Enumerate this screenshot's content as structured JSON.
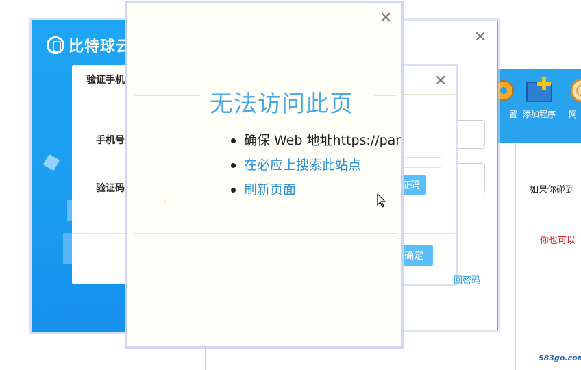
{
  "front_dialog": {
    "close_glyph": "✕",
    "title": "无法访问此页",
    "suggestions": [
      {
        "text": "确保 Web 地址https://par",
        "type": "plain"
      },
      {
        "text": "在必应上搜索此站点",
        "type": "link"
      },
      {
        "text": "刷新页面",
        "type": "link"
      }
    ]
  },
  "login_window": {
    "logo_text": "比特球云",
    "verify_dialog": {
      "title": "验证手机",
      "phone_label": "手机号",
      "code_label": "验证码"
    }
  },
  "middle_dialog": {
    "close_glyph": "✕",
    "inner_close_glyph": "✕",
    "get_code_button": "证码",
    "confirm_button": "确定",
    "find_password_link": "回密码"
  },
  "right_app": {
    "toolbar": [
      {
        "label": "置",
        "icon": "gear-icon"
      },
      {
        "label": "添加程序",
        "icon": "add-folder-icon"
      },
      {
        "label": "网",
        "icon": "globe-icon"
      }
    ],
    "text_line_1": "如果你碰到",
    "text_line_2": "你也可以",
    "watermark": "583go.com"
  },
  "colors": {
    "accent_blue": "#4aa8e6",
    "link_blue": "#2a8fd6",
    "button_blue": "#5bbef6",
    "login_blue": "#1ea6f4",
    "warning_red": "#e02020"
  }
}
